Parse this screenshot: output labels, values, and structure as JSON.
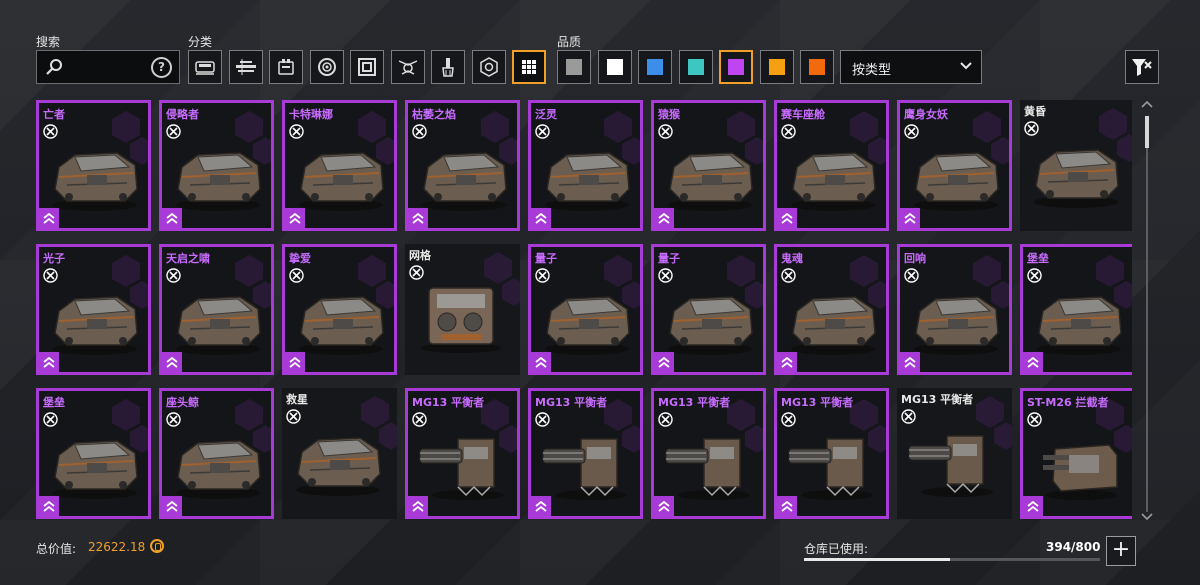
{
  "search": {
    "label": "搜索",
    "value": "",
    "help": "?"
  },
  "category": {
    "label": "分类",
    "buttons": [
      {
        "icon": "cabin-icon"
      },
      {
        "icon": "frame-icon"
      },
      {
        "icon": "engine-icon"
      },
      {
        "icon": "wheel-icon"
      },
      {
        "icon": "module-icon"
      },
      {
        "icon": "drone-icon"
      },
      {
        "icon": "brush-icon"
      },
      {
        "icon": "hex-settings-icon"
      },
      {
        "icon": "grid-all-icon",
        "active": true
      }
    ]
  },
  "quality": {
    "label": "品质",
    "swatches": [
      {
        "name": "grey",
        "color": "#9a9a9a"
      },
      {
        "name": "white",
        "color": "#ffffff"
      },
      {
        "name": "blue",
        "color": "#3d8ee8"
      },
      {
        "name": "teal",
        "color": "#3ec6c0"
      },
      {
        "name": "purple",
        "color": "#c045f2",
        "active": true
      },
      {
        "name": "orange",
        "color": "#f5a011"
      },
      {
        "name": "red-orange",
        "color": "#f26a0c"
      }
    ]
  },
  "sort": {
    "value": "按类型"
  },
  "items": [
    {
      "name": "亡者",
      "rarity": "purple",
      "kind": "cabin"
    },
    {
      "name": "侵略者",
      "rarity": "purple",
      "kind": "cabin"
    },
    {
      "name": "卡特琳娜",
      "rarity": "purple",
      "kind": "cabin"
    },
    {
      "name": "枯萎之焰",
      "rarity": "purple",
      "kind": "cabin"
    },
    {
      "name": "泛灵",
      "rarity": "purple",
      "kind": "cabin"
    },
    {
      "name": "猿猴",
      "rarity": "purple",
      "kind": "cabin"
    },
    {
      "name": "赛车座舱",
      "rarity": "purple",
      "kind": "cabin"
    },
    {
      "name": "鹰身女妖",
      "rarity": "purple",
      "kind": "cabin"
    },
    {
      "name": "黄昏",
      "rarity": "none",
      "kind": "cabin"
    },
    {
      "name": "光子",
      "rarity": "purple",
      "kind": "cabin"
    },
    {
      "name": "天启之啸",
      "rarity": "purple",
      "kind": "cabin"
    },
    {
      "name": "挚爱",
      "rarity": "purple",
      "kind": "cabin"
    },
    {
      "name": "网格",
      "rarity": "none",
      "kind": "engine"
    },
    {
      "name": "量子",
      "rarity": "purple",
      "kind": "cabin"
    },
    {
      "name": "量子",
      "rarity": "purple",
      "kind": "cabin"
    },
    {
      "name": "鬼魂",
      "rarity": "purple",
      "kind": "cabin"
    },
    {
      "name": "回响",
      "rarity": "purple",
      "kind": "cabin"
    },
    {
      "name": "堡垒",
      "rarity": "purple",
      "kind": "cabin"
    },
    {
      "name": "堡垒",
      "rarity": "purple",
      "kind": "cabin"
    },
    {
      "name": "座头鲸",
      "rarity": "purple",
      "kind": "cabin"
    },
    {
      "name": "救星",
      "rarity": "none",
      "kind": "cabin"
    },
    {
      "name": "MG13 平衡者",
      "rarity": "purple",
      "kind": "gun"
    },
    {
      "name": "MG13 平衡者",
      "rarity": "purple",
      "kind": "gun"
    },
    {
      "name": "MG13 平衡者",
      "rarity": "purple",
      "kind": "gun"
    },
    {
      "name": "MG13 平衡者",
      "rarity": "purple",
      "kind": "gun"
    },
    {
      "name": "MG13 平衡者",
      "rarity": "none",
      "kind": "gun"
    },
    {
      "name": "ST-M26 拦截者",
      "rarity": "purple",
      "kind": "turret"
    }
  ],
  "footer": {
    "total_label": "总价值:",
    "total_value": "22622.18",
    "storage_label": "仓库已使用:",
    "storage_value": "394/800",
    "storage_fraction": 0.4925,
    "add_label": "+"
  }
}
